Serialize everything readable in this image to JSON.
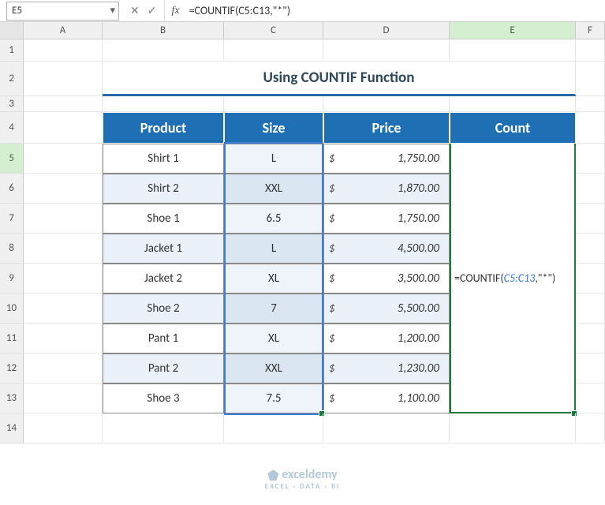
{
  "name_box": "E5",
  "formula": "=COUNTIF(C5:C13,\"*\")",
  "columns": [
    "A",
    "B",
    "C",
    "D",
    "E",
    "F"
  ],
  "rows": [
    "1",
    "2",
    "3",
    "4",
    "5",
    "6",
    "7",
    "8",
    "9",
    "10",
    "11",
    "12",
    "13",
    "14"
  ],
  "title": "Using COUNTIF Function",
  "headers": {
    "b": "Product",
    "c": "Size",
    "d": "Price",
    "e": "Count"
  },
  "data": [
    {
      "product": "Shirt 1",
      "size": "L",
      "price": "1,750.00"
    },
    {
      "product": "Shirt 2",
      "size": "XXL",
      "price": "1,870.00"
    },
    {
      "product": "Shoe 1",
      "size": "6.5",
      "price": "1,750.00"
    },
    {
      "product": "Jacket 1",
      "size": "L",
      "price": "4,500.00"
    },
    {
      "product": "Jacket 2",
      "size": "XL",
      "price": "3,500.00"
    },
    {
      "product": "Shoe 2",
      "size": "7",
      "price": "5,500.00"
    },
    {
      "product": "Pant 1",
      "size": "XL",
      "price": "1,200.00"
    },
    {
      "product": "Pant 2",
      "size": "XXL",
      "price": "1,230.00"
    },
    {
      "product": "Shoe 3",
      "size": "7.5",
      "price": "1,100.00"
    }
  ],
  "currency": "$",
  "count_display": {
    "p1": "=COUNTIF(",
    "ref": "C5:C13",
    "p2": ",\"*\")"
  },
  "watermark": "exceldemy",
  "watermark_sub": "EXCEL · DATA · BI"
}
